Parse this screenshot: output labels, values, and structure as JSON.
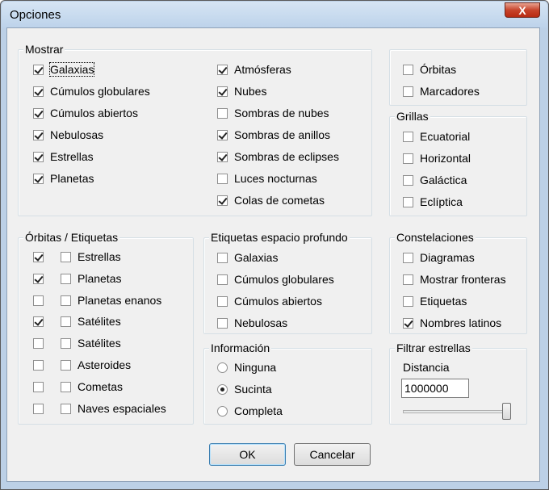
{
  "window": {
    "title": "Opciones",
    "close_label": "X"
  },
  "mostrar": {
    "legend": "Mostrar",
    "left": [
      {
        "label": "Galaxias",
        "checked": true
      },
      {
        "label": "Cúmulos globulares",
        "checked": true
      },
      {
        "label": "Cúmulos abiertos",
        "checked": true
      },
      {
        "label": "Nebulosas",
        "checked": true
      },
      {
        "label": "Estrellas",
        "checked": true
      },
      {
        "label": "Planetas",
        "checked": true
      }
    ],
    "right": [
      {
        "label": "Atmósferas",
        "checked": true
      },
      {
        "label": "Nubes",
        "checked": true
      },
      {
        "label": "Sombras de nubes",
        "checked": false
      },
      {
        "label": "Sombras de anillos",
        "checked": true
      },
      {
        "label": "Sombras de eclipses",
        "checked": true
      },
      {
        "label": "Luces nocturnas",
        "checked": false
      },
      {
        "label": "Colas de cometas",
        "checked": true
      }
    ]
  },
  "orbitas_marcadores": [
    {
      "label": "Órbitas",
      "checked": false
    },
    {
      "label": "Marcadores",
      "checked": false
    }
  ],
  "grillas": {
    "legend": "Grillas",
    "items": [
      {
        "label": "Ecuatorial",
        "checked": false
      },
      {
        "label": "Horizontal",
        "checked": false
      },
      {
        "label": "Galáctica",
        "checked": false
      },
      {
        "label": "Eclíptica",
        "checked": false
      }
    ]
  },
  "orbitas_etiquetas": {
    "legend": "Órbitas / Etiquetas",
    "items": [
      {
        "label": "Estrellas",
        "orbit": true,
        "label_checked": false
      },
      {
        "label": "Planetas",
        "orbit": true,
        "label_checked": false
      },
      {
        "label": "Planetas enanos",
        "orbit": false,
        "label_checked": false
      },
      {
        "label": "Satélites",
        "orbit": true,
        "label_checked": false
      },
      {
        "label": "Satélites",
        "orbit": false,
        "label_checked": false
      },
      {
        "label": "Asteroides",
        "orbit": false,
        "label_checked": false
      },
      {
        "label": "Cometas",
        "orbit": false,
        "label_checked": false
      },
      {
        "label": "Naves espaciales",
        "orbit": false,
        "label_checked": false
      }
    ]
  },
  "etiquetas_profundo": {
    "legend": "Etiquetas espacio profundo",
    "items": [
      {
        "label": "Galaxias",
        "checked": false
      },
      {
        "label": "Cúmulos globulares",
        "checked": false
      },
      {
        "label": "Cúmulos abiertos",
        "checked": false
      },
      {
        "label": "Nebulosas",
        "checked": false
      }
    ]
  },
  "constelaciones": {
    "legend": "Constelaciones",
    "items": [
      {
        "label": "Diagramas",
        "checked": false
      },
      {
        "label": "Mostrar fronteras",
        "checked": false
      },
      {
        "label": "Etiquetas",
        "checked": false
      },
      {
        "label": "Nombres latinos",
        "checked": true
      }
    ]
  },
  "informacion": {
    "legend": "Información",
    "selected": "Sucinta",
    "options": [
      "Ninguna",
      "Sucinta",
      "Completa"
    ]
  },
  "filtrar": {
    "legend": "Filtrar estrellas",
    "distance_label": "Distancia",
    "distance_value": "1000000",
    "slider_level": 1.0
  },
  "buttons": {
    "ok": "OK",
    "cancel": "Cancelar"
  }
}
